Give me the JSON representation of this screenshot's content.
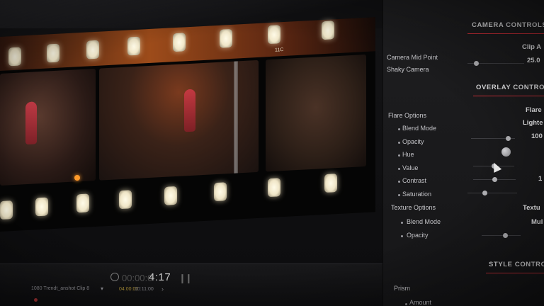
{
  "viewer": {
    "frame_marker": "11C",
    "timeline": {
      "timecode": "4:17",
      "timecode_dim": "00:00:0",
      "clip_name": "1080 Trendt_anshot Clip 8",
      "clip_in": "04:00:00",
      "clip_out": "10:11:00"
    }
  },
  "inspector": {
    "camera_controls": {
      "title": "CAMERA CONTROLS",
      "mid_point_label": "Camera Mid Point",
      "mid_point_value": "Clip A",
      "shaky_label": "Shaky Camera",
      "shaky_value": "25.0",
      "shaky_level": 0.15
    },
    "overlay_controls": {
      "title": "OVERLAY CONTRO",
      "flare_label": "Flare Options",
      "flare_value": "Flare",
      "blend_label": "Blend Mode",
      "blend_value": "Lighte",
      "opacity_label": "Opacity",
      "opacity_value": "100",
      "opacity_level": 0.85,
      "hue_label": "Hue",
      "value_label": "Value",
      "value_level": 0.5,
      "contrast_label": "Contrast",
      "contrast_value": "1",
      "contrast_level": 0.5,
      "saturation_label": "Saturation",
      "saturation_level": 0.35,
      "texture_label": "Texture Options",
      "texture_value": "Textu",
      "tex_blend_label": "Blend Mode",
      "tex_blend_value": "Mul",
      "tex_opacity_label": "Opacity",
      "tex_opacity_level": 0.6
    },
    "style_controls": {
      "title": "STYLE CONTRO",
      "prism_label": "Prism",
      "amount_label": "Amount"
    },
    "colors": {
      "accent": "#d2303a"
    }
  }
}
